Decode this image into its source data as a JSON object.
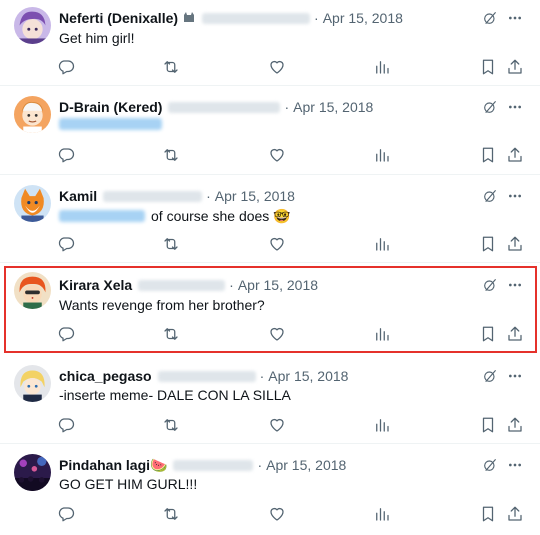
{
  "tweets": [
    {
      "name": "Neferti (Denixalle)",
      "date": "Apr 15, 2018",
      "text": "Get him girl!",
      "avatar": "anime-purple-hair-avatar"
    },
    {
      "name": "D-Brain (Kered)",
      "date": "Apr 15, 2018",
      "text": "",
      "avatar": "orange-cartoon-character-avatar"
    },
    {
      "name": "Kamil",
      "date": "Apr 15, 2018",
      "text": "of course she does 🤓",
      "avatar": "fox-character-avatar"
    },
    {
      "name": "Kirara Xela",
      "date": "Apr 15, 2018",
      "text": "Wants revenge from her brother?",
      "avatar": "orange-hair-character-avatar"
    },
    {
      "name": "chica_pegaso",
      "date": "Apr 15, 2018",
      "text": "-inserte meme- DALE CON LA SILLA",
      "avatar": "blonde-anime-character-avatar"
    },
    {
      "name": "Pindahan lagi🍉",
      "date": "Apr 15, 2018",
      "text": "GO GET HIM GURL!!!",
      "avatar": "concert-crowd-avatar"
    }
  ],
  "separator": "·",
  "icons": {
    "reply": "reply-icon",
    "retweet": "retweet-icon",
    "like": "heart-icon",
    "views": "views-bar-icon",
    "bookmark": "bookmark-icon",
    "share": "share-icon",
    "grok": "grok-icon",
    "more": "more-icon"
  },
  "colors": {
    "highlight": "#e5312b",
    "icon": "#536471",
    "text": "#0f1419",
    "muted": "#536471"
  }
}
